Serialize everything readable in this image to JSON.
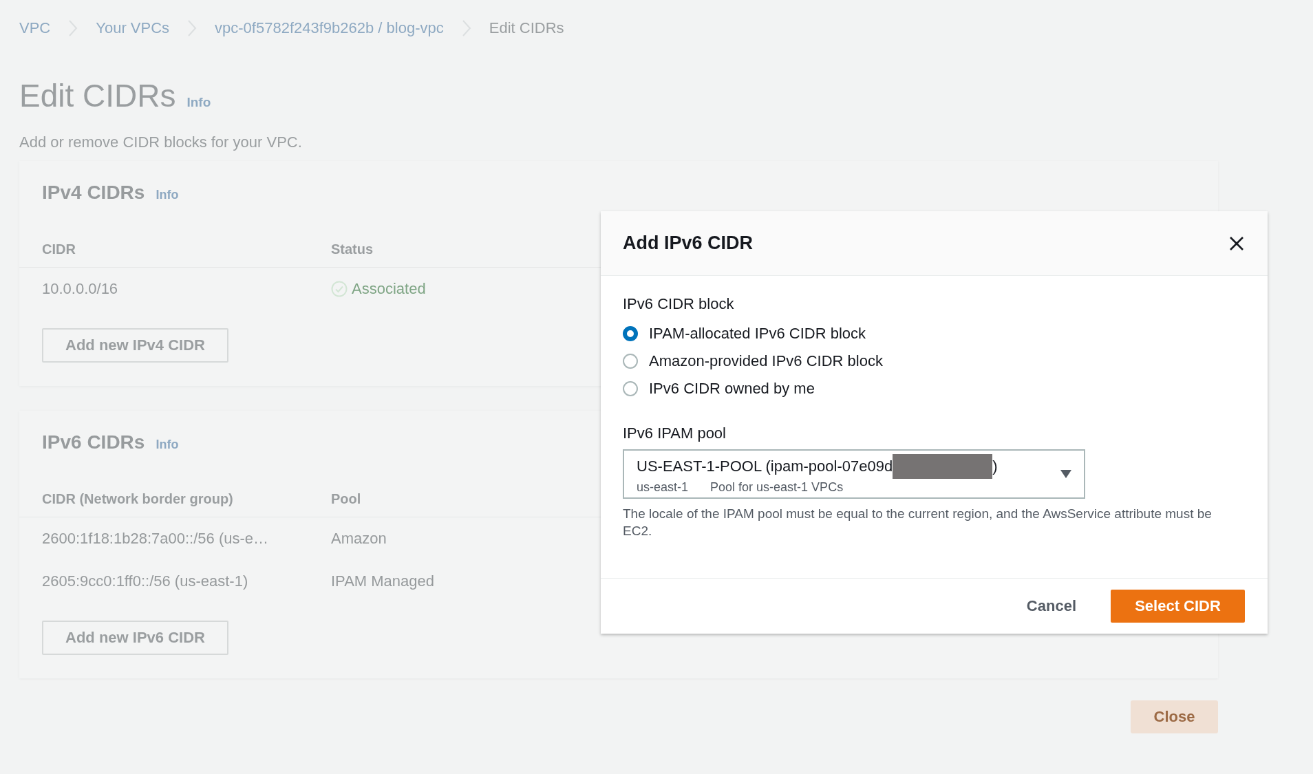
{
  "breadcrumbs": [
    "VPC",
    "Your VPCs",
    "vpc-0f5782f243f9b262b / blog-vpc",
    "Edit CIDRs"
  ],
  "page": {
    "title": "Edit CIDRs",
    "info": "Info",
    "description": "Add or remove CIDR blocks for your VPC."
  },
  "sections": [
    {
      "title": "IPv4 CIDRs",
      "info": "Info",
      "columns": [
        "CIDR",
        "Status"
      ],
      "rows": [
        {
          "cidr": "10.0.0.0/16",
          "value": "Associated",
          "kind": "status"
        }
      ],
      "add_button": "Add new IPv4 CIDR"
    },
    {
      "title": "IPv6 CIDRs",
      "info": "Info",
      "columns": [
        "CIDR (Network border group)",
        "Pool"
      ],
      "rows": [
        {
          "cidr": "2600:1f18:1b28:7a00::/56 (us-e…",
          "value": "Amazon",
          "kind": "text"
        },
        {
          "cidr": "2605:9cc0:1ff0::/56 (us-east-1)",
          "value": "IPAM Managed",
          "kind": "text"
        }
      ],
      "add_button": "Add new IPv6 CIDR"
    }
  ],
  "close_button": "Close",
  "modal": {
    "title": "Add IPv6 CIDR",
    "block_label": "IPv6 CIDR block",
    "options": [
      {
        "label": "IPAM-allocated IPv6 CIDR block",
        "selected": true
      },
      {
        "label": "Amazon-provided IPv6 CIDR block",
        "selected": false
      },
      {
        "label": "IPv6 CIDR owned by me",
        "selected": false
      }
    ],
    "pool_label": "IPv6 IPAM pool",
    "pool": {
      "value": "US-EAST-1-POOL (ipam-pool-07e09d",
      "value_end": ")",
      "locale": "us-east-1",
      "description": "Pool for us-east-1 VPCs"
    },
    "hint": "The locale of the IPAM pool must be equal to the current region, and the AwsService attribute must be EC2.",
    "cancel": "Cancel",
    "submit": "Select CIDR"
  }
}
